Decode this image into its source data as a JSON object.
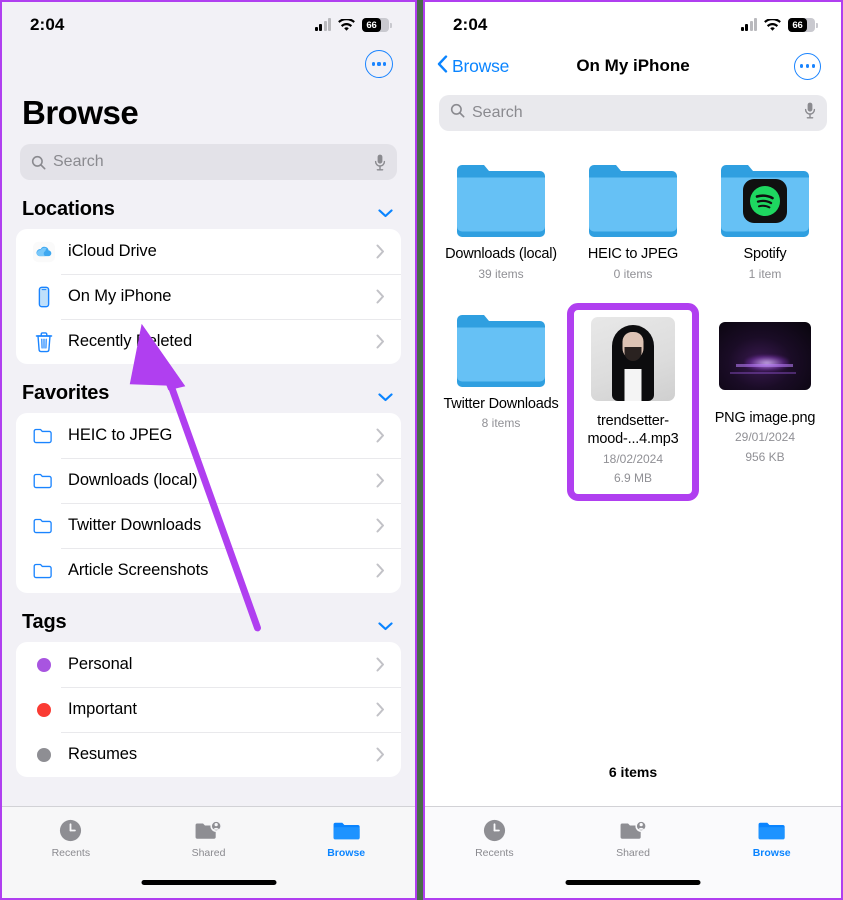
{
  "accent": {
    "annotation_purple": "#b03ff0",
    "ios_blue": "#0a84ff",
    "folder_blue": "#57b9f5",
    "divider_green": "#4a6b4a"
  },
  "left_panel": {
    "status": {
      "time": "2:04",
      "battery_level": "66"
    },
    "more_button": "more-options",
    "title": "Browse",
    "search": {
      "placeholder": "Search"
    },
    "sections": [
      {
        "header": "Locations",
        "items": [
          {
            "label": "iCloud Drive",
            "icon": "icloud-icon"
          },
          {
            "label": "On My iPhone",
            "icon": "iphone-icon"
          },
          {
            "label": "Recently Deleted",
            "icon": "trash-icon"
          }
        ]
      },
      {
        "header": "Favorites",
        "items": [
          {
            "label": "HEIC to JPEG",
            "icon": "folder-icon"
          },
          {
            "label": "Downloads (local)",
            "icon": "folder-icon"
          },
          {
            "label": "Twitter Downloads",
            "icon": "folder-icon"
          },
          {
            "label": "Article Screenshots",
            "icon": "folder-icon"
          }
        ]
      },
      {
        "header": "Tags",
        "items": [
          {
            "label": "Personal",
            "icon": "tag-dot-icon",
            "color": "#a855e0"
          },
          {
            "label": "Important",
            "icon": "tag-dot-icon",
            "color": "#fa3b33"
          },
          {
            "label": "Resumes",
            "icon": "tag-dot-icon",
            "color": "#8e8e93"
          }
        ]
      }
    ],
    "tabs": [
      {
        "label": "Recents",
        "icon": "clock-icon",
        "active": false
      },
      {
        "label": "Shared",
        "icon": "shared-folder-icon",
        "active": false
      },
      {
        "label": "Browse",
        "icon": "folder-icon",
        "active": true
      }
    ]
  },
  "right_panel": {
    "status": {
      "time": "2:04",
      "battery_level": "66"
    },
    "nav": {
      "back_label": "Browse",
      "title": "On My iPhone",
      "more_button": "more-options"
    },
    "search": {
      "placeholder": "Search"
    },
    "files": [
      {
        "name": "Downloads (local)",
        "meta1": "39 items",
        "meta2": "",
        "kind": "folder",
        "selected": false
      },
      {
        "name": "HEIC to JPEG",
        "meta1": "0 items",
        "meta2": "",
        "kind": "folder",
        "selected": false
      },
      {
        "name": "Spotify",
        "meta1": "1 item",
        "meta2": "",
        "kind": "folder-app",
        "badge": "spotify-icon",
        "selected": false
      },
      {
        "name": "Twitter Downloads",
        "meta1": "8 items",
        "meta2": "",
        "kind": "folder",
        "selected": false
      },
      {
        "name": "trendsetter-mood-...4.mp3",
        "meta1": "18/02/2024",
        "meta2": "6.9 MB",
        "kind": "photo-person",
        "selected": true
      },
      {
        "name": "PNG image.png",
        "meta1": "29/01/2024",
        "meta2": "956 KB",
        "kind": "photo-dark",
        "selected": false
      }
    ],
    "item_count": "6 items",
    "tabs": [
      {
        "label": "Recents",
        "icon": "clock-icon",
        "active": false
      },
      {
        "label": "Shared",
        "icon": "shared-folder-icon",
        "active": false
      },
      {
        "label": "Browse",
        "icon": "folder-icon",
        "active": true
      }
    ]
  },
  "annotation": {
    "arrow": "purple-arrow-pointing-to-on-my-iphone"
  }
}
